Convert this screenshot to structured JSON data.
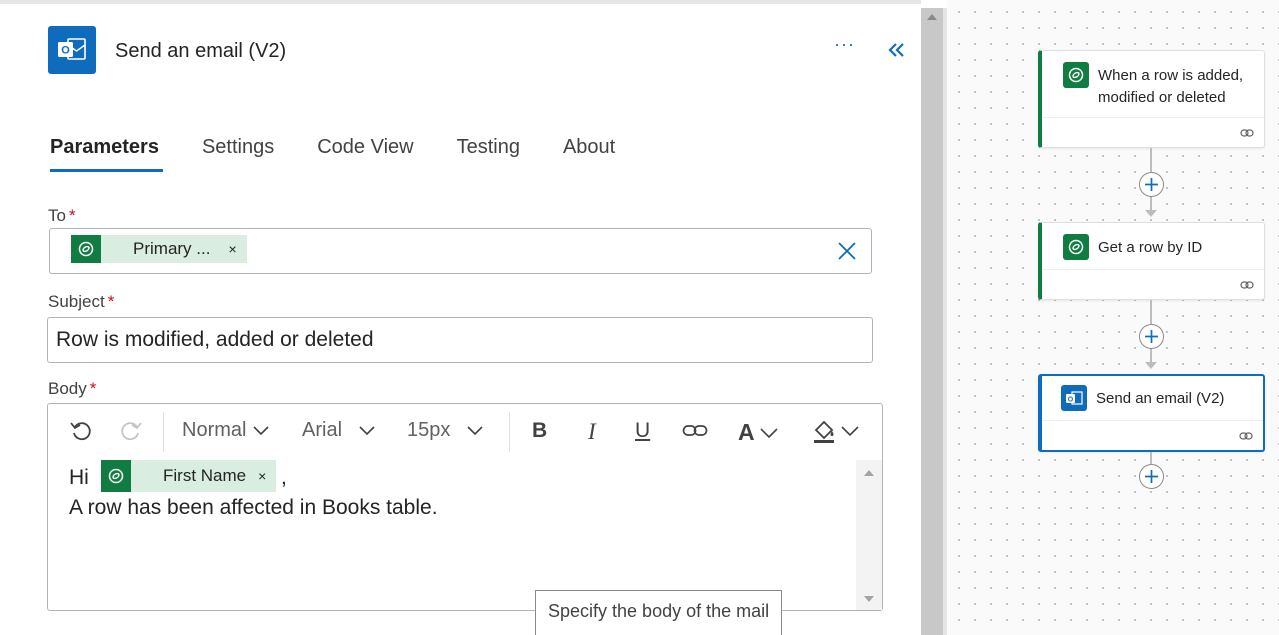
{
  "panel": {
    "title": "Send an email (V2)",
    "more_label": "···",
    "tabs": [
      {
        "label": "Parameters",
        "active": true
      },
      {
        "label": "Settings",
        "active": false
      },
      {
        "label": "Code View",
        "active": false
      },
      {
        "label": "Testing",
        "active": false
      },
      {
        "label": "About",
        "active": false
      }
    ],
    "to": {
      "label": "To",
      "required_mark": "*",
      "token_label": "Primary ...",
      "token_close": "×"
    },
    "subject": {
      "label": "Subject",
      "required_mark": "*",
      "value": "Row is modified, added or deleted"
    },
    "body": {
      "label": "Body",
      "required_mark": "*",
      "toolbar": {
        "paragraph_style": "Normal",
        "font": "Arial",
        "font_size": "15px",
        "bold": "B",
        "italic": "I",
        "underline": "U",
        "font_color": "A"
      },
      "line1_prefix": "Hi",
      "token_label": "First Name",
      "token_close": "×",
      "line1_suffix": ",",
      "line2": "A row has been affected in Books table.",
      "tooltip": "Specify the body of the mail"
    }
  },
  "flow": {
    "nodes": [
      {
        "title_line1": "When a row is added,",
        "title_line2": "modified or deleted",
        "icon": "dataverse-icon"
      },
      {
        "title_line1": "Get a row by ID",
        "title_line2": "",
        "icon": "dataverse-icon"
      },
      {
        "title_line1": "Send an email (V2)",
        "title_line2": "",
        "icon": "outlook-icon",
        "selected": true
      }
    ]
  },
  "colors": {
    "accent": "#0f6cbd",
    "dataverse": "#107c41",
    "token_bg": "#d9eee0",
    "required": "#c50f1f"
  }
}
